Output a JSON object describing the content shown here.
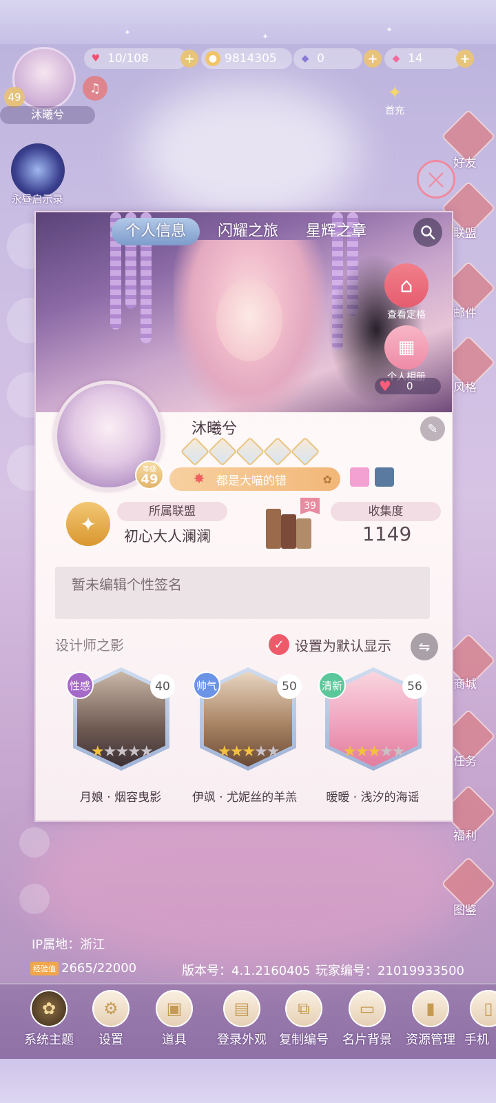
{
  "hud": {
    "stamina": "10/108",
    "coins": "9814305",
    "gems_blue": "0",
    "diamonds": "14",
    "first_charge_label": "首充"
  },
  "top_profile": {
    "name": "沐曦兮",
    "level": "49"
  },
  "left_event": {
    "label": "永昼启示录"
  },
  "side_menu": [
    "好友",
    "联盟",
    "邮件",
    "风格",
    "商城",
    "任务",
    "福利",
    "图鉴"
  ],
  "panel": {
    "tabs": [
      "个人信息",
      "闪耀之旅",
      "星辉之章"
    ],
    "view_pose_label": "查看定格",
    "album_label": "个人相册",
    "likes": "0",
    "player_name": "沐曦兮",
    "level_tag": "等级",
    "level": "49",
    "title": "都是大喵的错",
    "alliance_label": "所属联盟",
    "alliance_name": "初心大人澜澜",
    "collection_count_badge": "39",
    "collection_label": "收集度",
    "collection_value": "1149",
    "signature": "暂未编辑个性签名",
    "designer_section": "设计师之影",
    "default_display_label": "设置为默认显示",
    "cards": [
      {
        "tag": "性感",
        "tag_color": "#a569c8",
        "level": "40",
        "stars_on": 1,
        "caption": "月娘 · 烟容曳影"
      },
      {
        "tag": "帅气",
        "tag_color": "#6b93e6",
        "level": "50",
        "stars_on": 3,
        "caption": "伊飒 · 尤妮丝的羊羔"
      },
      {
        "tag": "清新",
        "tag_color": "#5cc79a",
        "level": "56",
        "stars_on": 3,
        "caption": "暧暧 · 浅汐的海谣"
      }
    ]
  },
  "footer": {
    "ip": "IP属地：浙江",
    "exp_tag": "经验值",
    "exp": "2665/22000",
    "version": "版本号：4.1.2160405",
    "player_id": "玩家编号：21019933500"
  },
  "bottom_nav": [
    "系统主题",
    "设置",
    "道具",
    "登录外观",
    "复制编号",
    "名片背景",
    "资源管理",
    "手机"
  ]
}
